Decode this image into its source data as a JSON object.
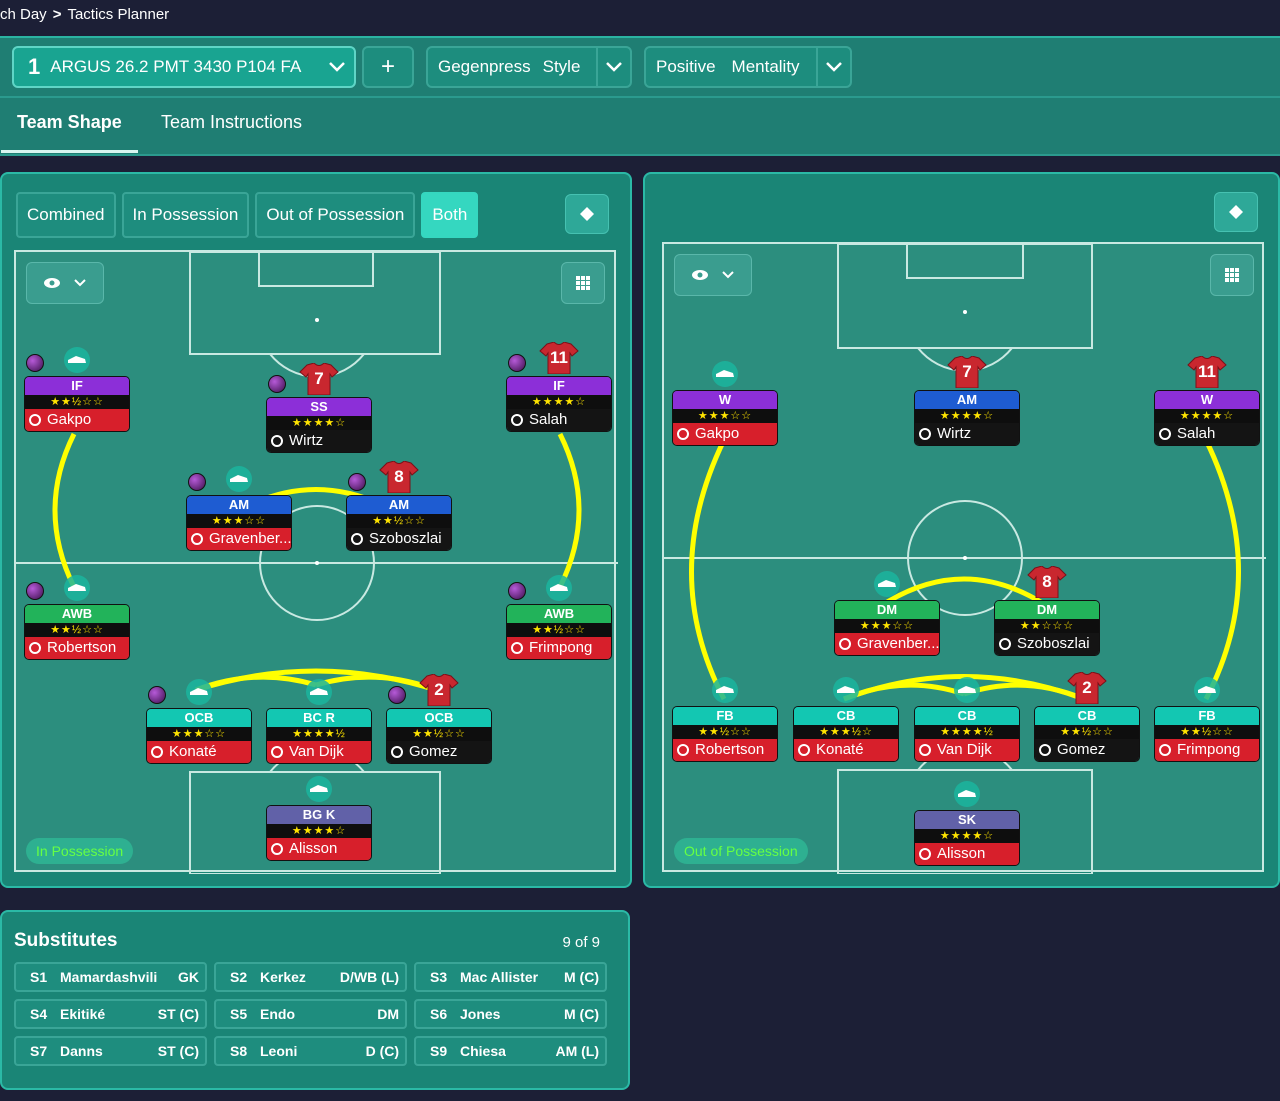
{
  "breadcrumb": {
    "parent": "ch Day",
    "current": "Tactics Planner"
  },
  "tactic": {
    "number": "1",
    "name": "ARGUS 26.2 PMT 3430 P104 FA",
    "add": "+"
  },
  "style": {
    "value": "Gegenpress",
    "label": "Style"
  },
  "mentality": {
    "value": "Positive",
    "label": "Mentality"
  },
  "tabs": {
    "shape": "Team Shape",
    "instructions": "Team Instructions"
  },
  "phase_tabs": [
    "Combined",
    "In Possession",
    "Out of Possession",
    "Both"
  ],
  "left_pitch": {
    "tag": "In Possession",
    "players": [
      {
        "role": "IF",
        "stars": "★★½☆☆",
        "name": "Gakpo",
        "nameStyle": "red",
        "number": ""
      },
      {
        "role": "SS",
        "stars": "★★★★☆",
        "name": "Wirtz",
        "nameStyle": "dark",
        "number": "7"
      },
      {
        "role": "IF",
        "stars": "★★★★☆",
        "name": "Salah",
        "nameStyle": "dark",
        "number": "11"
      },
      {
        "role": "AM",
        "stars": "★★★☆☆",
        "name": "Gravenber...",
        "nameStyle": "red",
        "number": ""
      },
      {
        "role": "AM",
        "stars": "★★½☆☆",
        "name": "Szoboszlai",
        "nameStyle": "dark",
        "number": "8"
      },
      {
        "role": "AWB",
        "stars": "★★½☆☆",
        "name": "Robertson",
        "nameStyle": "red",
        "number": ""
      },
      {
        "role": "AWB",
        "stars": "★★½☆☆",
        "name": "Frimpong",
        "nameStyle": "red",
        "number": ""
      },
      {
        "role": "OCB",
        "stars": "★★★☆☆",
        "name": "Konaté",
        "nameStyle": "red",
        "number": ""
      },
      {
        "role": "BC R",
        "stars": "★★★★½",
        "name": "Van Dijk",
        "nameStyle": "red",
        "number": ""
      },
      {
        "role": "OCB",
        "stars": "★★½☆☆",
        "name": "Gomez",
        "nameStyle": "dark",
        "number": "2"
      },
      {
        "role": "BG K",
        "stars": "★★★★☆",
        "name": "Alisson",
        "nameStyle": "red",
        "number": ""
      }
    ]
  },
  "right_pitch": {
    "tag": "Out of Possession",
    "players": [
      {
        "role": "W",
        "stars": "★★★☆☆",
        "name": "Gakpo",
        "nameStyle": "red",
        "number": ""
      },
      {
        "role": "AM",
        "stars": "★★★★☆",
        "name": "Wirtz",
        "nameStyle": "dark",
        "number": "7"
      },
      {
        "role": "W",
        "stars": "★★★★☆",
        "name": "Salah",
        "nameStyle": "dark",
        "number": "11"
      },
      {
        "role": "DM",
        "stars": "★★★☆☆",
        "name": "Gravenber...",
        "nameStyle": "red",
        "number": ""
      },
      {
        "role": "DM",
        "stars": "★★☆☆☆",
        "name": "Szoboszlai",
        "nameStyle": "dark",
        "number": "8"
      },
      {
        "role": "FB",
        "stars": "★★½☆☆",
        "name": "Robertson",
        "nameStyle": "red",
        "number": ""
      },
      {
        "role": "CB",
        "stars": "★★★½☆",
        "name": "Konaté",
        "nameStyle": "red",
        "number": ""
      },
      {
        "role": "CB",
        "stars": "★★★★½",
        "name": "Van Dijk",
        "nameStyle": "red",
        "number": ""
      },
      {
        "role": "CB",
        "stars": "★★½☆☆",
        "name": "Gomez",
        "nameStyle": "dark",
        "number": "2"
      },
      {
        "role": "FB",
        "stars": "★★½☆☆",
        "name": "Frimpong",
        "nameStyle": "red",
        "number": ""
      },
      {
        "role": "SK",
        "stars": "★★★★☆",
        "name": "Alisson",
        "nameStyle": "red",
        "number": ""
      }
    ]
  },
  "substitutes": {
    "title": "Substitutes",
    "count": "9 of 9",
    "items": [
      {
        "id": "S1",
        "name": "Mamardashvili",
        "pos": "GK"
      },
      {
        "id": "S2",
        "name": "Kerkez",
        "pos": "D/WB (L)"
      },
      {
        "id": "S3",
        "name": "Mac Allister",
        "pos": "M (C)"
      },
      {
        "id": "S4",
        "name": "Ekitiké",
        "pos": "ST (C)"
      },
      {
        "id": "S5",
        "name": "Endo",
        "pos": "DM"
      },
      {
        "id": "S6",
        "name": "Jones",
        "pos": "M (C)"
      },
      {
        "id": "S7",
        "name": "Danns",
        "pos": "ST (C)"
      },
      {
        "id": "S8",
        "name": "Leoni",
        "pos": "D (C)"
      },
      {
        "id": "S9",
        "name": "Chiesa",
        "pos": "AM (L)"
      }
    ]
  },
  "colors": {
    "panel": "#1a8576",
    "accent": "#35d7c0",
    "link": "#ffff00",
    "red": "#d71f2b"
  }
}
